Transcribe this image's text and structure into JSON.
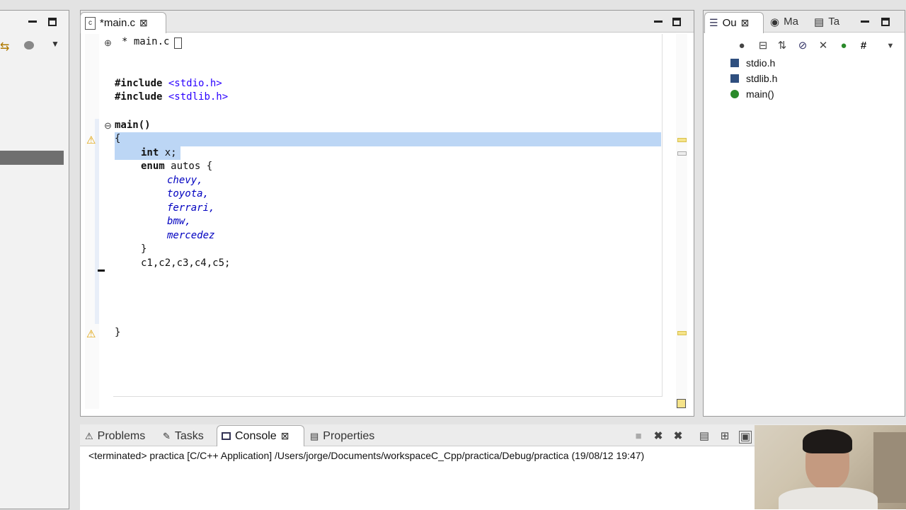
{
  "editor": {
    "tab_label": "*main.c",
    "close_glyph": "⊠",
    "header_line": "* main.c",
    "code": {
      "include1_kw": "#include",
      "include1_arg": "<stdio.h>",
      "include2_kw": "#include",
      "include2_arg": "<stdlib.h>",
      "main_sig": "main()",
      "open_brace": "{",
      "int_kw": "int",
      "int_rest": " x;",
      "enum_kw": "enum",
      "enum_rest": " autos {",
      "values": [
        "chevy,",
        "toyota,",
        "ferrari,",
        "bmw,",
        "mercedez"
      ],
      "enum_close": "}",
      "vars_line": "c1,c2,c3,c4,c5;",
      "close_brace": "}"
    }
  },
  "outline": {
    "tabs": [
      {
        "label": "Ou",
        "icon": "outline-icon"
      },
      {
        "label": "Ma",
        "icon": "macro-icon"
      },
      {
        "label": "Ta",
        "icon": "task-icon"
      }
    ],
    "items": [
      {
        "label": "stdio.h",
        "icon": "include-icon"
      },
      {
        "label": "stdlib.h",
        "icon": "include-icon"
      },
      {
        "label": "main()",
        "icon": "function-icon"
      }
    ]
  },
  "bottom": {
    "tabs": [
      {
        "label": "Problems",
        "icon": "problems-icon"
      },
      {
        "label": "Tasks",
        "icon": "tasks-icon"
      },
      {
        "label": "Console",
        "icon": "console-icon"
      },
      {
        "label": "Properties",
        "icon": "properties-icon"
      }
    ],
    "console_text": "<terminated> practica [C/C++ Application] /Users/jorge/Documents/workspaceC_Cpp/practica/Debug/practica (19/08/12 19:47)"
  },
  "colors": {
    "selection": "#bcd6f5",
    "warning": "#e0a100",
    "overview_marker": "#f5e38a"
  }
}
